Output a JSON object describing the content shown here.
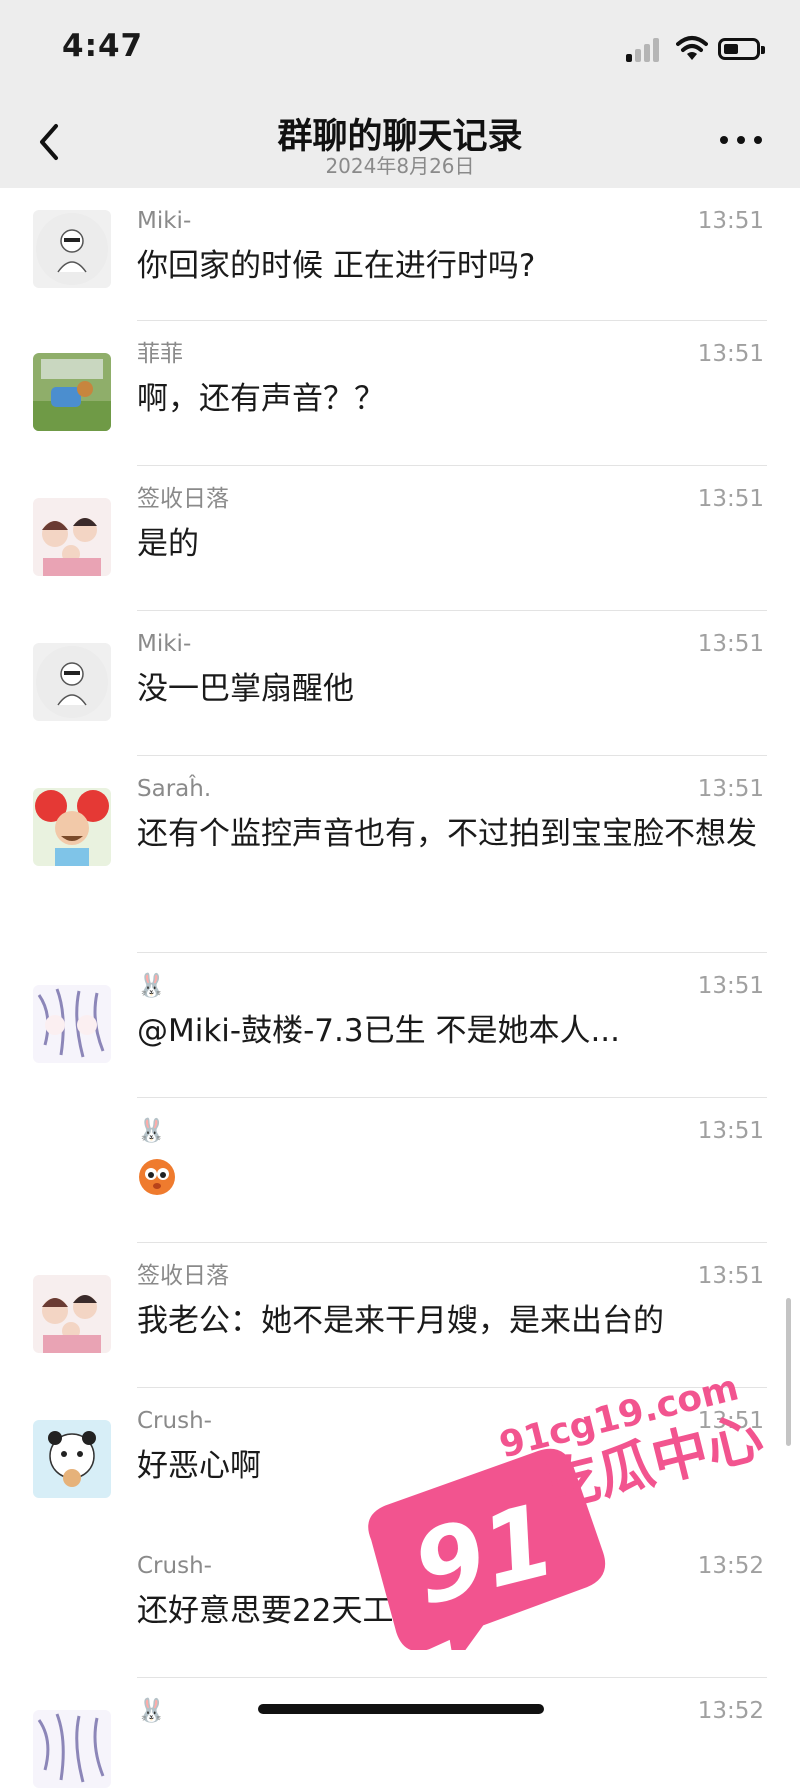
{
  "status": {
    "time": "4:47"
  },
  "nav": {
    "title": "群聊的聊天记录",
    "date": "2024年8月26日"
  },
  "messages": [
    {
      "sender": "Miki-",
      "time": "13:51",
      "text": "你回家的时候 正在进行时吗?"
    },
    {
      "sender": "菲菲",
      "time": "13:51",
      "text": "啊，还有声音？？"
    },
    {
      "sender": "签收日落",
      "time": "13:51",
      "text": "是的"
    },
    {
      "sender": "Miki-",
      "time": "13:51",
      "text": "没一巴掌扇醒他"
    },
    {
      "sender": "Saraĥ.",
      "time": "13:51",
      "text": "还有个监控声音也有，不过拍到宝宝脸不想发"
    },
    {
      "sender": "🐰",
      "time": "13:51",
      "text": "@Miki-鼓楼-7.3已生 不是她本人..."
    },
    {
      "sender": "🐰",
      "time": "13:51",
      "text": ""
    },
    {
      "sender": "签收日落",
      "time": "13:51",
      "text": "我老公：她不是来干月嫂，是来出台的"
    },
    {
      "sender": "Crush-",
      "time": "13:51",
      "text": "好恶心啊"
    },
    {
      "sender": "Crush-",
      "time": "13:52",
      "text": "还好意思要22天工钱"
    },
    {
      "sender": "🐰",
      "time": "13:52",
      "text": ""
    }
  ],
  "watermark": {
    "number": "91",
    "site": "91cg19.com",
    "brand": "吃瓜中心"
  },
  "colors": {
    "background": "#ffffff",
    "header": "#ededed",
    "watermark": "#f2548f"
  }
}
